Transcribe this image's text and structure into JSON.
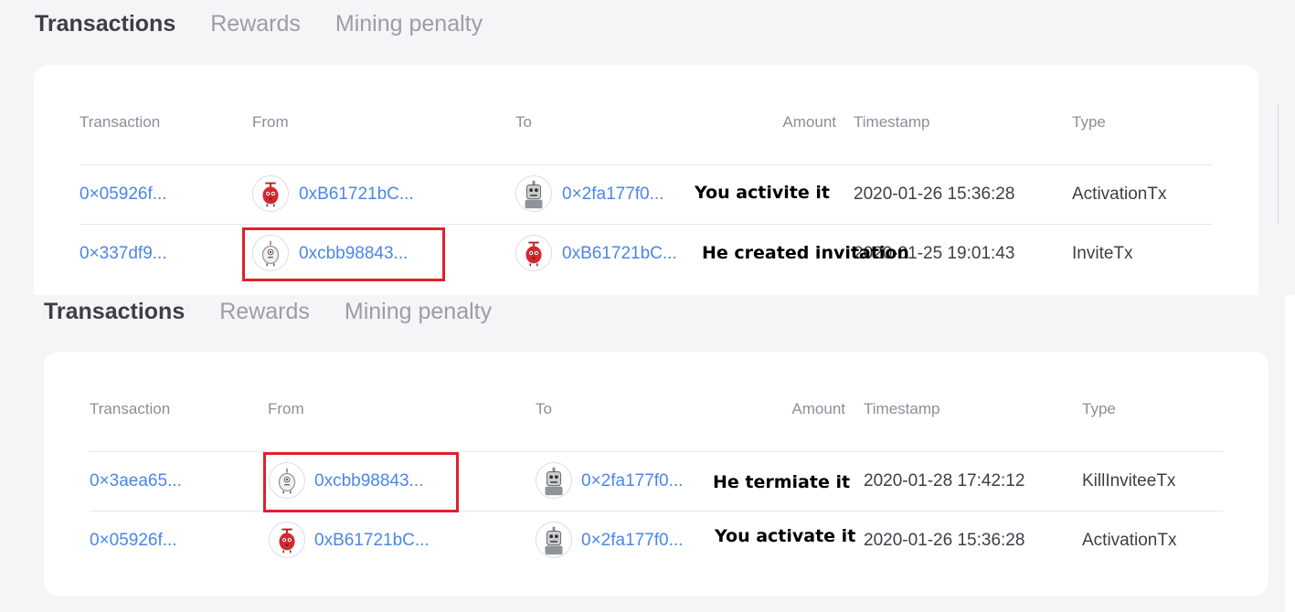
{
  "top": {
    "tabs": [
      "Transactions",
      "Rewards",
      "Mining penalty"
    ],
    "headers": {
      "transaction": "Transaction",
      "from": "From",
      "to": "To",
      "amount": "Amount",
      "timestamp": "Timestamp",
      "type": "Type"
    },
    "rows": [
      {
        "tx": "0×05926f...",
        "from": "0xB61721bC...",
        "from_avatar": "red-bird-avatar",
        "to": "0×2fa177f0...",
        "to_avatar": "grey-robot-avatar",
        "amount_note": "You activite it",
        "timestamp": "2020-01-26 15:36:28",
        "type": "ActivationTx"
      },
      {
        "tx": "0×337df9...",
        "from": "0xcbb98843...",
        "from_avatar": "white-bird-avatar",
        "to": "0xB61721bC...",
        "to_avatar": "red-bird-avatar",
        "amount_note": "He created invitation",
        "timestamp": "2020-01-25 19:01:43",
        "type": "InviteTx"
      }
    ]
  },
  "bottom": {
    "tabs": [
      "Transactions",
      "Rewards",
      "Mining penalty"
    ],
    "headers": {
      "transaction": "Transaction",
      "from": "From",
      "to": "To",
      "amount": "Amount",
      "timestamp": "Timestamp",
      "type": "Type"
    },
    "rows": [
      {
        "tx": "0×3aea65...",
        "from": "0xcbb98843...",
        "from_avatar": "white-bird-avatar",
        "to": "0×2fa177f0...",
        "to_avatar": "grey-robot-avatar",
        "amount_note": "He termiate it",
        "timestamp": "2020-01-28 17:42:12",
        "type": "KillInviteeTx"
      },
      {
        "tx": "0×05926f...",
        "from": "0xB61721bC...",
        "from_avatar": "red-bird-avatar",
        "to": "0×2fa177f0...",
        "to_avatar": "grey-robot-avatar",
        "amount_note": "You activate it",
        "timestamp": "2020-01-26 15:36:28",
        "type": "ActivationTx"
      }
    ]
  },
  "colors": {
    "link": "#4a86e8",
    "highlight": "#e0202a",
    "background": "#f4f5f7",
    "card": "#ffffff"
  }
}
